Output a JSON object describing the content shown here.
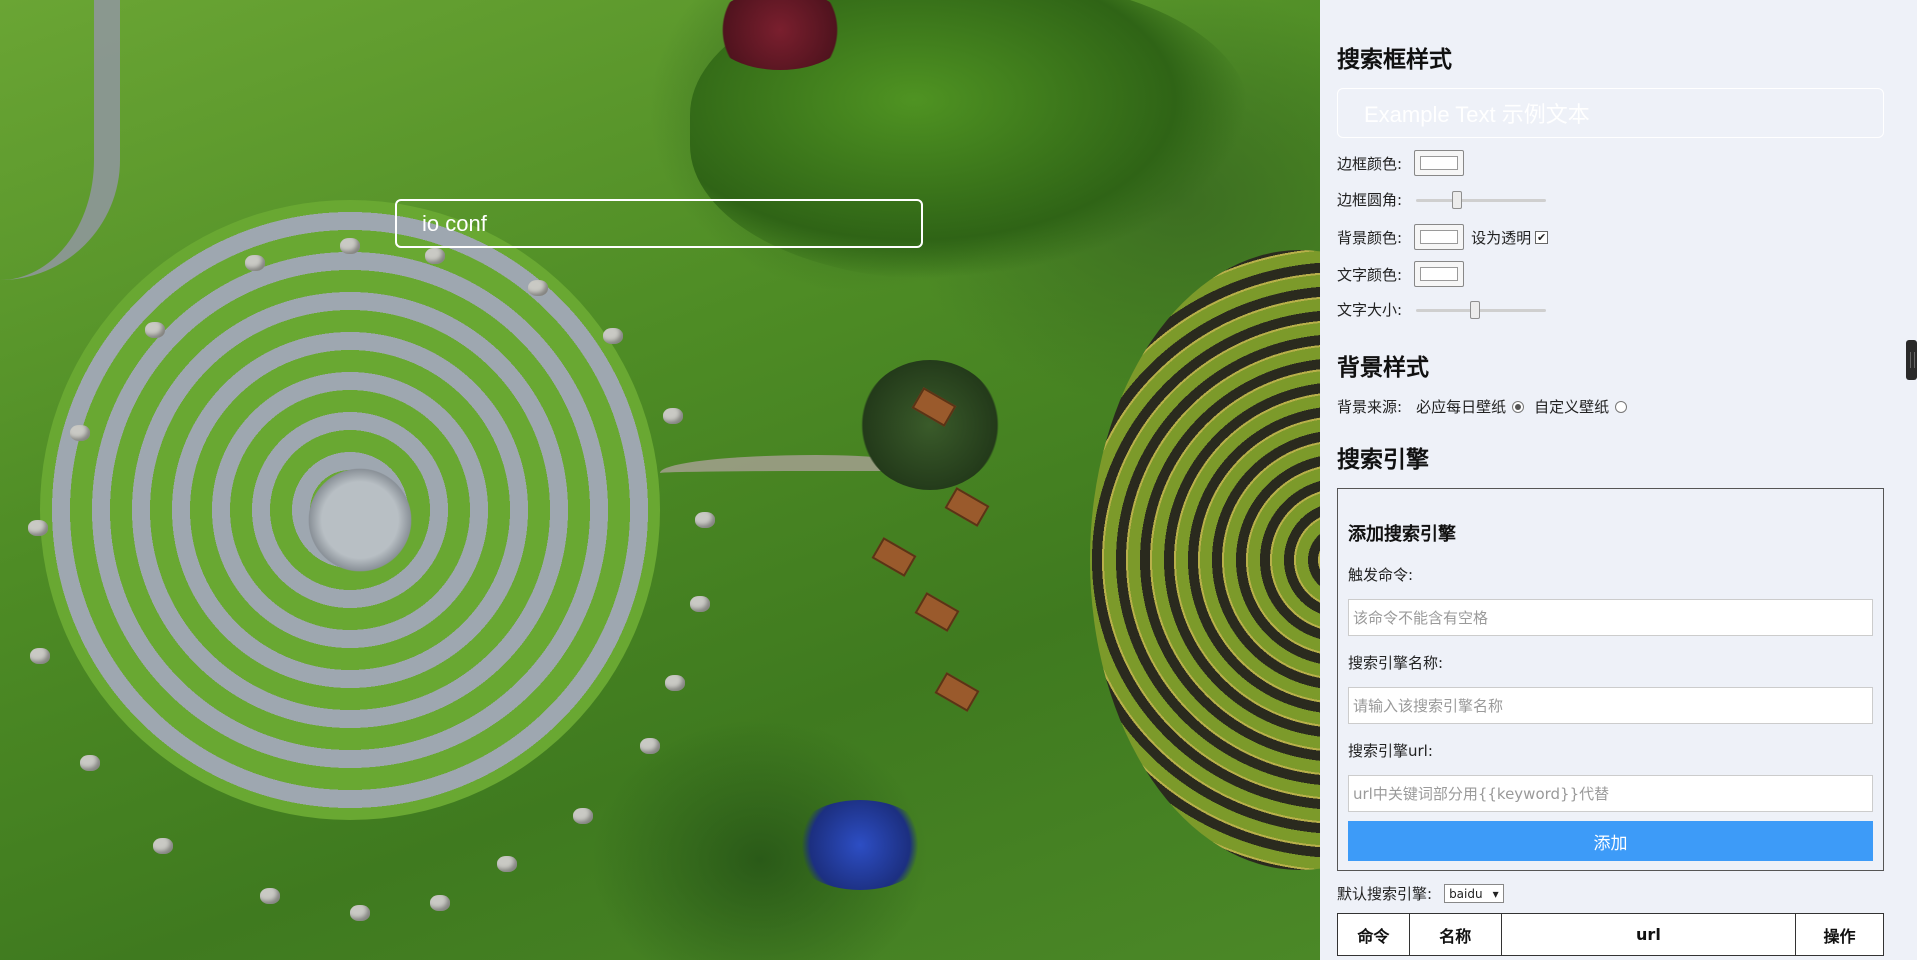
{
  "search": {
    "value": "io conf"
  },
  "panel": {
    "search_style": {
      "title": "搜索框样式",
      "preview_text": "Example Text 示例文本",
      "border_color_label": "边框颜色:",
      "border_radius_label": "边框圆角:",
      "border_radius_level": 0.3,
      "bg_color_label": "背景颜色:",
      "transparent_label": "设为透明",
      "transparent_checked": true,
      "text_color_label": "文字颜色:",
      "text_size_label": "文字大小:",
      "text_size_level": 0.45
    },
    "background_style": {
      "title": "背景样式",
      "source_label": "背景来源:",
      "options": [
        {
          "label": "必应每日壁纸",
          "selected": true
        },
        {
          "label": "自定义壁纸",
          "selected": false
        }
      ]
    },
    "search_engine": {
      "title": "搜索引擎",
      "add": {
        "title": "添加搜索引擎",
        "command_label": "触发命令:",
        "command_placeholder": "该命令不能含有空格",
        "name_label": "搜索引擎名称:",
        "name_placeholder": "请输入该搜索引擎名称",
        "url_label": "搜索引擎url:",
        "url_placeholder": "url中关键词部分用{{keyword}}代替",
        "button_label": "添加"
      },
      "default_label": "默认搜索引擎:",
      "default_value": "baidu",
      "table_headers": [
        "命令",
        "名称",
        "url",
        "操作"
      ]
    }
  },
  "colors": {
    "panel_bg": "#eef1f8",
    "accent": "#3d9bf8"
  }
}
